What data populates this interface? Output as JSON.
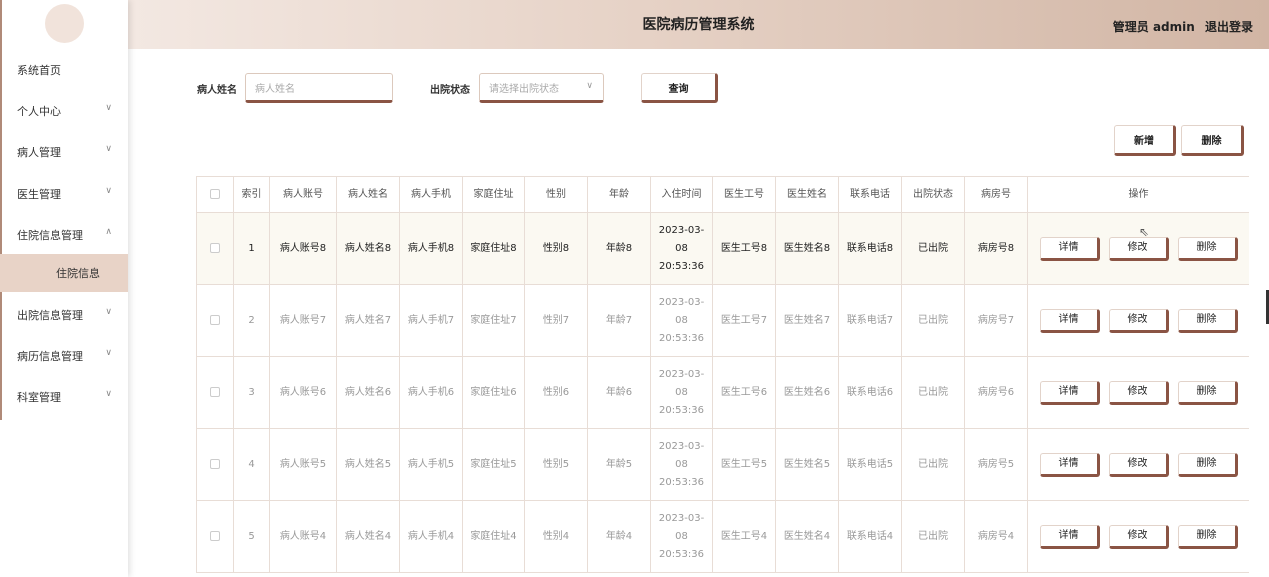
{
  "header": {
    "title": "医院病历管理系统",
    "user": "管理员 admin",
    "logout": "退出登录"
  },
  "sidebar": {
    "items": [
      {
        "label": "系统首页",
        "has_children": false
      },
      {
        "label": "个人中心",
        "has_children": true,
        "chevron": "∨"
      },
      {
        "label": "病人管理",
        "has_children": true,
        "chevron": "∨"
      },
      {
        "label": "医生管理",
        "has_children": true,
        "chevron": "∨"
      },
      {
        "label": "住院信息管理",
        "has_children": true,
        "chevron": "∧",
        "expanded": true
      },
      {
        "label": "出院信息管理",
        "has_children": true,
        "chevron": "∨"
      },
      {
        "label": "病历信息管理",
        "has_children": true,
        "chevron": "∨"
      },
      {
        "label": "科室管理",
        "has_children": true,
        "chevron": "∨"
      }
    ],
    "sub_item": {
      "label": "住院信息"
    }
  },
  "search": {
    "name_label": "病人姓名",
    "name_placeholder": "病人姓名",
    "status_label": "出院状态",
    "status_placeholder": "请选择出院状态",
    "query_button": "查询"
  },
  "actions": {
    "add": "新增",
    "delete": "删除"
  },
  "table": {
    "columns": [
      "",
      "索引",
      "病人账号",
      "病人姓名",
      "病人手机",
      "家庭住址",
      "性别",
      "年龄",
      "入住时间",
      "医生工号",
      "医生姓名",
      "联系电话",
      "出院状态",
      "病房号",
      "操作"
    ],
    "row_actions": {
      "detail": "详情",
      "edit": "修改",
      "delete": "删除"
    },
    "rows": [
      {
        "index": "1",
        "account": "病人账号8",
        "name": "病人姓名8",
        "phone": "病人手机8",
        "address": "家庭住址8",
        "gender": "性别8",
        "age": "年龄8",
        "checkin": "2023-03-08 20:53:36",
        "doctor_no": "医生工号8",
        "doctor_name": "医生姓名8",
        "contact": "联系电话8",
        "status": "已出院",
        "room": "病房号8"
      },
      {
        "index": "2",
        "account": "病人账号7",
        "name": "病人姓名7",
        "phone": "病人手机7",
        "address": "家庭住址7",
        "gender": "性别7",
        "age": "年龄7",
        "checkin": "2023-03-08 20:53:36",
        "doctor_no": "医生工号7",
        "doctor_name": "医生姓名7",
        "contact": "联系电话7",
        "status": "已出院",
        "room": "病房号7"
      },
      {
        "index": "3",
        "account": "病人账号6",
        "name": "病人姓名6",
        "phone": "病人手机6",
        "address": "家庭住址6",
        "gender": "性别6",
        "age": "年龄6",
        "checkin": "2023-03-08 20:53:36",
        "doctor_no": "医生工号6",
        "doctor_name": "医生姓名6",
        "contact": "联系电话6",
        "status": "已出院",
        "room": "病房号6"
      },
      {
        "index": "4",
        "account": "病人账号5",
        "name": "病人姓名5",
        "phone": "病人手机5",
        "address": "家庭住址5",
        "gender": "性别5",
        "age": "年龄5",
        "checkin": "2023-03-08 20:53:36",
        "doctor_no": "医生工号5",
        "doctor_name": "医生姓名5",
        "contact": "联系电话5",
        "status": "已出院",
        "room": "病房号5"
      },
      {
        "index": "5",
        "account": "病人账号4",
        "name": "病人姓名4",
        "phone": "病人手机4",
        "address": "家庭住址4",
        "gender": "性别4",
        "age": "年龄4",
        "checkin": "2023-03-08 20:53:36",
        "doctor_no": "医生工号4",
        "doctor_name": "医生姓名4",
        "contact": "联系电话4",
        "status": "已出院",
        "room": "病房号4"
      }
    ]
  },
  "colors": {
    "accent": "#8a5444",
    "header_start": "#f3e8e2",
    "header_end": "#d1b5a4",
    "active_submenu": "#e8d3c7",
    "active_row": "#fbf9f2"
  }
}
